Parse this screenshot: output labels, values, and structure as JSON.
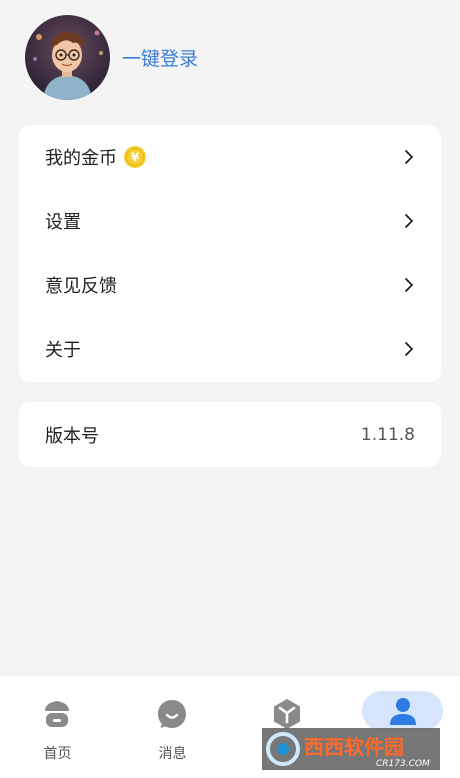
{
  "profile": {
    "login_label": "一键登录"
  },
  "menu": {
    "items": [
      {
        "label": "我的金币",
        "icon": "coin-icon"
      },
      {
        "label": "设置"
      },
      {
        "label": "意见反馈"
      },
      {
        "label": "关于"
      }
    ],
    "coin_symbol": "¥"
  },
  "version": {
    "label": "版本号",
    "value": "1.11.8"
  },
  "tabbar": {
    "tabs": [
      {
        "label": "首页",
        "icon": "home-icon"
      },
      {
        "label": "消息",
        "icon": "message-icon"
      },
      {
        "label": "",
        "icon": "cube-icon"
      },
      {
        "label": "",
        "icon": "user-icon",
        "active": true
      }
    ]
  },
  "watermark": {
    "text": "西西软件园",
    "subtext": "CR173.COM"
  },
  "colors": {
    "background": "#f4f4f4",
    "card": "#ffffff",
    "accent": "#3a7bd5",
    "active_pill": "#d6e5fb",
    "coin": "#f5cf2e"
  }
}
